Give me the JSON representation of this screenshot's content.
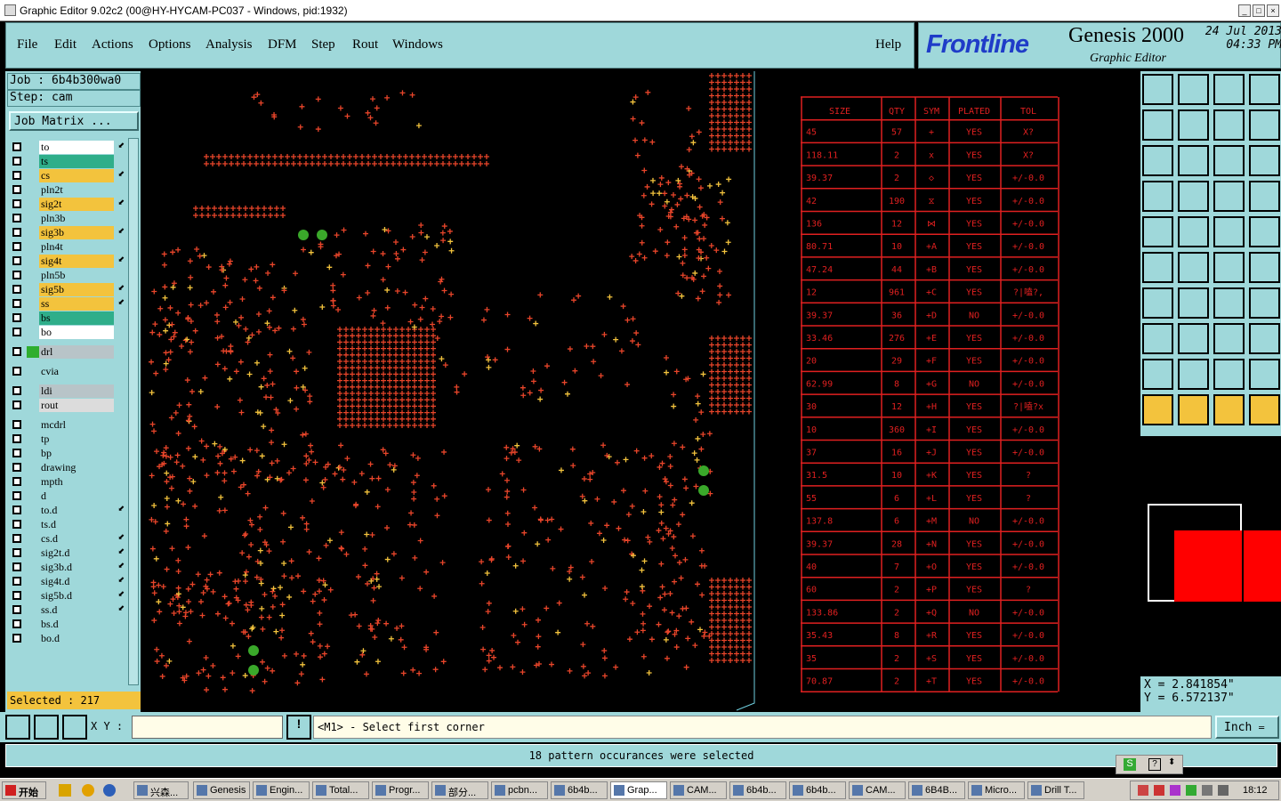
{
  "window": {
    "title": "Graphic Editor 9.02c2 (00@HY-HYCAM-PC037 - Windows, pid:1932)"
  },
  "menu": {
    "items": [
      "File",
      "Edit",
      "Actions",
      "Options",
      "Analysis",
      "DFM",
      "Step",
      "Rout",
      "Windows"
    ],
    "help": "Help"
  },
  "brand": {
    "logo": "Frontline",
    "product": "Genesis 2000",
    "subtitle": "Graphic Editor",
    "date": "24 Jul 2013",
    "time": "04:33 PM"
  },
  "job": {
    "job_line": "Job :  6b4b300wa0",
    "step_line": "Step:  cam",
    "job_matrix_label": "Job Matrix ..."
  },
  "layers": [
    {
      "name": "to",
      "color": "#ffffff",
      "arrow": true
    },
    {
      "name": "ts",
      "color": "#2fae8a",
      "arrow": false
    },
    {
      "name": "cs",
      "color": "#f3c33d",
      "arrow": true
    },
    {
      "name": "pln2t",
      "color": "#9fd8da",
      "arrow": false
    },
    {
      "name": "sig2t",
      "color": "#f3c33d",
      "arrow": true
    },
    {
      "name": "pln3b",
      "color": "#9fd8da",
      "arrow": false
    },
    {
      "name": "sig3b",
      "color": "#f3c33d",
      "arrow": true
    },
    {
      "name": "pln4t",
      "color": "#9fd8da",
      "arrow": false
    },
    {
      "name": "sig4t",
      "color": "#f3c33d",
      "arrow": true
    },
    {
      "name": "pln5b",
      "color": "#9fd8da",
      "arrow": false
    },
    {
      "name": "sig5b",
      "color": "#f3c33d",
      "arrow": true
    },
    {
      "name": "ss",
      "color": "#f3c33d",
      "arrow": true
    },
    {
      "name": "bs",
      "color": "#2fae8a",
      "arrow": false
    },
    {
      "name": "bo",
      "color": "#ffffff",
      "arrow": false
    },
    {
      "name": "drl",
      "color": "#b8c4c8",
      "arrow": false
    },
    {
      "name": "cvia",
      "color": "#9fd8da",
      "arrow": false
    },
    {
      "name": "ldi",
      "color": "#b8c4c8",
      "arrow": false
    },
    {
      "name": "rout",
      "color": "#dcdcdc",
      "arrow": false
    },
    {
      "name": "mcdrl",
      "color": "#9fd8da",
      "arrow": false
    },
    {
      "name": "tp",
      "color": "#9fd8da",
      "arrow": false
    },
    {
      "name": "bp",
      "color": "#9fd8da",
      "arrow": false
    },
    {
      "name": "drawing",
      "color": "#9fd8da",
      "arrow": false
    },
    {
      "name": "mpth",
      "color": "#9fd8da",
      "arrow": false
    },
    {
      "name": "d",
      "color": "#9fd8da",
      "arrow": false
    },
    {
      "name": "to.d",
      "color": "#9fd8da",
      "arrow": true
    },
    {
      "name": "ts.d",
      "color": "#9fd8da",
      "arrow": false
    },
    {
      "name": "cs.d",
      "color": "#9fd8da",
      "arrow": true
    },
    {
      "name": "sig2t.d",
      "color": "#9fd8da",
      "arrow": true
    },
    {
      "name": "sig3b.d",
      "color": "#9fd8da",
      "arrow": true
    },
    {
      "name": "sig4t.d",
      "color": "#9fd8da",
      "arrow": true
    },
    {
      "name": "sig5b.d",
      "color": "#9fd8da",
      "arrow": true
    },
    {
      "name": "ss.d",
      "color": "#9fd8da",
      "arrow": true
    },
    {
      "name": "bs.d",
      "color": "#9fd8da",
      "arrow": false
    },
    {
      "name": "bo.d",
      "color": "#9fd8da",
      "arrow": false
    }
  ],
  "selected_label": "Selected : 217",
  "drill_table": {
    "headers": [
      "SIZE",
      "QTY",
      "SYM",
      "PLATED",
      "TOL"
    ],
    "rows": [
      [
        "45",
        "57",
        "+",
        "YES",
        "X?"
      ],
      [
        "118.11",
        "2",
        "x",
        "YES",
        "X?"
      ],
      [
        "39.37",
        "2",
        "◇",
        "YES",
        "+/-0.0"
      ],
      [
        "42",
        "190",
        "⧖",
        "YES",
        "+/-0.0"
      ],
      [
        "136",
        "12",
        "⋈",
        "YES",
        "+/-0.0"
      ],
      [
        "80.71",
        "10",
        "+A",
        "YES",
        "+/-0.0"
      ],
      [
        "47.24",
        "44",
        "+B",
        "YES",
        "+/-0.0"
      ],
      [
        "12",
        "961",
        "+C",
        "YES",
        "?|嗑?,"
      ],
      [
        "39.37",
        "36",
        "+D",
        "NO",
        "+/-0.0"
      ],
      [
        "33.46",
        "276",
        "+E",
        "YES",
        "+/-0.0"
      ],
      [
        "20",
        "29",
        "+F",
        "YES",
        "+/-0.0"
      ],
      [
        "62.99",
        "8",
        "+G",
        "NO",
        "+/-0.0"
      ],
      [
        "30",
        "12",
        "+H",
        "YES",
        "?|嗑?x"
      ],
      [
        "10",
        "360",
        "+I",
        "YES",
        "+/-0.0"
      ],
      [
        "37",
        "16",
        "+J",
        "YES",
        "+/-0.0"
      ],
      [
        "31.5",
        "10",
        "+K",
        "YES",
        "?"
      ],
      [
        "55",
        "6",
        "+L",
        "YES",
        "?"
      ],
      [
        "137.8",
        "6",
        "+M",
        "NO",
        "+/-0.0"
      ],
      [
        "39.37",
        "28",
        "+N",
        "YES",
        "+/-0.0"
      ],
      [
        "40",
        "7",
        "+O",
        "YES",
        "+/-0.0"
      ],
      [
        "60",
        "2",
        "+P",
        "YES",
        "?"
      ],
      [
        "133.86",
        "2",
        "+Q",
        "NO",
        "+/-0.0"
      ],
      [
        "35.43",
        "8",
        "+R",
        "YES",
        "+/-0.0"
      ],
      [
        "35",
        "2",
        "+S",
        "YES",
        "+/-0.0"
      ],
      [
        "70.87",
        "2",
        "+T",
        "YES",
        "+/-0.0"
      ]
    ]
  },
  "coords": {
    "x": "X  =  2.841854\"",
    "y": "Y  =  6.572137\""
  },
  "bottom": {
    "xy_label": "X Y :",
    "xy_value": "",
    "prompt": "<M1> - Select first corner",
    "unit": "Inch"
  },
  "status": "18 pattern occurances were selected",
  "taskbar": {
    "start": "开始",
    "tasks": [
      "兴森...",
      "Genesis",
      "Engin...",
      "Total...",
      "Progr...",
      "部分...",
      "pcbn...",
      "6b4b...",
      "Grap...",
      "CAM...",
      "6b4b...",
      "6b4b...",
      "CAM...",
      "6B4B...",
      "Micro...",
      "Drill T..."
    ],
    "clock": "18:12"
  },
  "colors": {
    "panel": "#9fd8da",
    "drill": "#e8452a",
    "accent": "#f3c33d",
    "table_line": "#e02020"
  }
}
